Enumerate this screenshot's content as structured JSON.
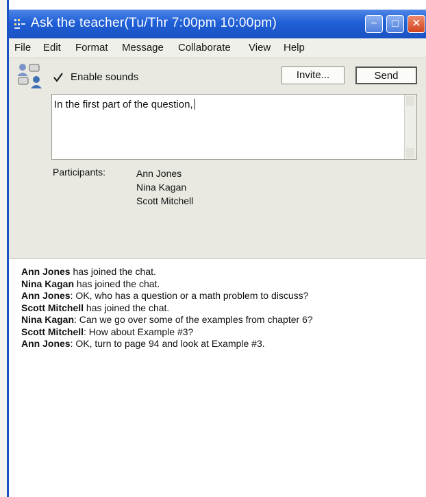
{
  "window": {
    "title": "Ask the teacher(Tu/Thr 7:00pm 10:00pm)"
  },
  "menu": [
    "File",
    "Edit",
    "Format",
    "Message",
    "Collaborate",
    "View",
    "Help"
  ],
  "toolbar": {
    "enable_sounds_label": "Enable sounds",
    "enable_sounds_checked": true,
    "invite_label": "Invite...",
    "send_label": "Send"
  },
  "compose": {
    "value": "In the first part of the question,"
  },
  "participants": {
    "label": "Participants:",
    "names": [
      "Ann Jones",
      "Nina Kagan",
      "Scott Mitchell"
    ]
  },
  "chat": [
    {
      "name": "Ann Jones",
      "text": " has joined the chat."
    },
    {
      "name": "Nina Kagan",
      "text": " has joined the chat."
    },
    {
      "name": "Ann Jones",
      "text": ": OK, who has a question or a math problem to discuss?"
    },
    {
      "name": "Scott Mitchell",
      "text": " has joined the chat."
    },
    {
      "name": "Nina Kagan",
      "text": ": Can we go over some of the examples from chapter 6?"
    },
    {
      "name": "Scott Mitchell",
      "text": ": How about Example #3?"
    },
    {
      "name": "Ann Jones",
      "text": ": OK, turn to page 94 and look at Example #3."
    }
  ],
  "colors": {
    "titlebar": "#1f5fd6",
    "close_button": "#d0451f",
    "panel": "#e9e9e2"
  }
}
